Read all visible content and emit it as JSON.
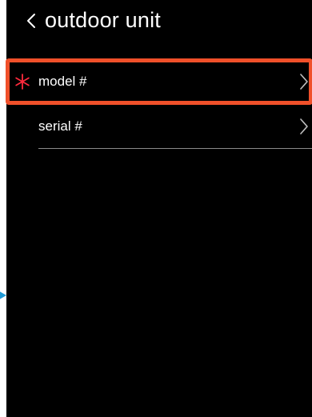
{
  "header": {
    "title": "outdoor unit",
    "back_icon": "chevron-left-icon"
  },
  "list": {
    "items": [
      {
        "label": "model #",
        "required": true,
        "icon": "asterisk-icon",
        "chevron": "chevron-right-icon",
        "highlighted": true
      },
      {
        "label": "serial #",
        "required": false,
        "chevron": "chevron-right-icon",
        "highlighted": false
      }
    ]
  },
  "colors": {
    "background": "#000000",
    "text": "#ffffff",
    "highlight_border": "#f0502a",
    "required_icon": "#ff2a3d",
    "divider": "#8a8a8a",
    "side_indicator": "#1f9ad6"
  }
}
